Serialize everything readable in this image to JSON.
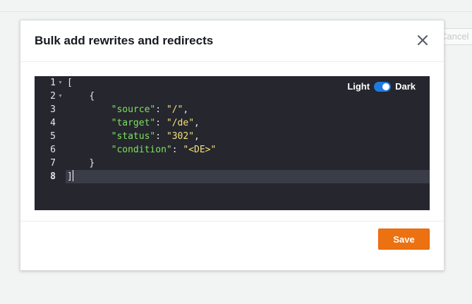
{
  "background": {
    "cancel_label": "Cancel"
  },
  "modal": {
    "title": "Bulk add rewrites and redirects",
    "close_icon": "close-icon",
    "save_label": "Save"
  },
  "editor": {
    "theme": {
      "light_label": "Light",
      "dark_label": "Dark",
      "dark_enabled": true
    },
    "line_numbers": [
      "1",
      "2",
      "3",
      "4",
      "5",
      "6",
      "7",
      "8"
    ],
    "fold_markers": [
      "1",
      "2"
    ],
    "active_line": "8",
    "lines": {
      "l1": "[",
      "l2": "{",
      "l3_key": "\"source\"",
      "l3_val": "\"/\"",
      "l4_key": "\"target\"",
      "l4_val": "\"/de\"",
      "l5_key": "\"status\"",
      "l5_val": "\"302\"",
      "l6_key": "\"condition\"",
      "l6_val": "\"<DE>\"",
      "l7": "}",
      "l8": "]"
    }
  },
  "colors": {
    "editor_bg": "#25262e",
    "json_key": "#7ee35e",
    "json_string": "#f2e07a",
    "save_button": "#ec7211",
    "toggle_on": "#1f7ae0"
  }
}
